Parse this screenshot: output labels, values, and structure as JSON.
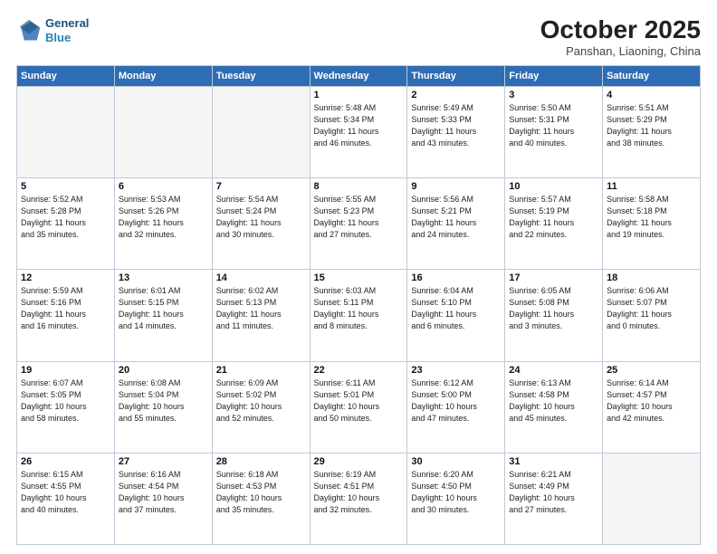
{
  "header": {
    "logo_line1": "General",
    "logo_line2": "Blue",
    "month": "October 2025",
    "location": "Panshan, Liaoning, China"
  },
  "weekdays": [
    "Sunday",
    "Monday",
    "Tuesday",
    "Wednesday",
    "Thursday",
    "Friday",
    "Saturday"
  ],
  "weeks": [
    [
      {
        "day": "",
        "info": ""
      },
      {
        "day": "",
        "info": ""
      },
      {
        "day": "",
        "info": ""
      },
      {
        "day": "1",
        "info": "Sunrise: 5:48 AM\nSunset: 5:34 PM\nDaylight: 11 hours\nand 46 minutes."
      },
      {
        "day": "2",
        "info": "Sunrise: 5:49 AM\nSunset: 5:33 PM\nDaylight: 11 hours\nand 43 minutes."
      },
      {
        "day": "3",
        "info": "Sunrise: 5:50 AM\nSunset: 5:31 PM\nDaylight: 11 hours\nand 40 minutes."
      },
      {
        "day": "4",
        "info": "Sunrise: 5:51 AM\nSunset: 5:29 PM\nDaylight: 11 hours\nand 38 minutes."
      }
    ],
    [
      {
        "day": "5",
        "info": "Sunrise: 5:52 AM\nSunset: 5:28 PM\nDaylight: 11 hours\nand 35 minutes."
      },
      {
        "day": "6",
        "info": "Sunrise: 5:53 AM\nSunset: 5:26 PM\nDaylight: 11 hours\nand 32 minutes."
      },
      {
        "day": "7",
        "info": "Sunrise: 5:54 AM\nSunset: 5:24 PM\nDaylight: 11 hours\nand 30 minutes."
      },
      {
        "day": "8",
        "info": "Sunrise: 5:55 AM\nSunset: 5:23 PM\nDaylight: 11 hours\nand 27 minutes."
      },
      {
        "day": "9",
        "info": "Sunrise: 5:56 AM\nSunset: 5:21 PM\nDaylight: 11 hours\nand 24 minutes."
      },
      {
        "day": "10",
        "info": "Sunrise: 5:57 AM\nSunset: 5:19 PM\nDaylight: 11 hours\nand 22 minutes."
      },
      {
        "day": "11",
        "info": "Sunrise: 5:58 AM\nSunset: 5:18 PM\nDaylight: 11 hours\nand 19 minutes."
      }
    ],
    [
      {
        "day": "12",
        "info": "Sunrise: 5:59 AM\nSunset: 5:16 PM\nDaylight: 11 hours\nand 16 minutes."
      },
      {
        "day": "13",
        "info": "Sunrise: 6:01 AM\nSunset: 5:15 PM\nDaylight: 11 hours\nand 14 minutes."
      },
      {
        "day": "14",
        "info": "Sunrise: 6:02 AM\nSunset: 5:13 PM\nDaylight: 11 hours\nand 11 minutes."
      },
      {
        "day": "15",
        "info": "Sunrise: 6:03 AM\nSunset: 5:11 PM\nDaylight: 11 hours\nand 8 minutes."
      },
      {
        "day": "16",
        "info": "Sunrise: 6:04 AM\nSunset: 5:10 PM\nDaylight: 11 hours\nand 6 minutes."
      },
      {
        "day": "17",
        "info": "Sunrise: 6:05 AM\nSunset: 5:08 PM\nDaylight: 11 hours\nand 3 minutes."
      },
      {
        "day": "18",
        "info": "Sunrise: 6:06 AM\nSunset: 5:07 PM\nDaylight: 11 hours\nand 0 minutes."
      }
    ],
    [
      {
        "day": "19",
        "info": "Sunrise: 6:07 AM\nSunset: 5:05 PM\nDaylight: 10 hours\nand 58 minutes."
      },
      {
        "day": "20",
        "info": "Sunrise: 6:08 AM\nSunset: 5:04 PM\nDaylight: 10 hours\nand 55 minutes."
      },
      {
        "day": "21",
        "info": "Sunrise: 6:09 AM\nSunset: 5:02 PM\nDaylight: 10 hours\nand 52 minutes."
      },
      {
        "day": "22",
        "info": "Sunrise: 6:11 AM\nSunset: 5:01 PM\nDaylight: 10 hours\nand 50 minutes."
      },
      {
        "day": "23",
        "info": "Sunrise: 6:12 AM\nSunset: 5:00 PM\nDaylight: 10 hours\nand 47 minutes."
      },
      {
        "day": "24",
        "info": "Sunrise: 6:13 AM\nSunset: 4:58 PM\nDaylight: 10 hours\nand 45 minutes."
      },
      {
        "day": "25",
        "info": "Sunrise: 6:14 AM\nSunset: 4:57 PM\nDaylight: 10 hours\nand 42 minutes."
      }
    ],
    [
      {
        "day": "26",
        "info": "Sunrise: 6:15 AM\nSunset: 4:55 PM\nDaylight: 10 hours\nand 40 minutes."
      },
      {
        "day": "27",
        "info": "Sunrise: 6:16 AM\nSunset: 4:54 PM\nDaylight: 10 hours\nand 37 minutes."
      },
      {
        "day": "28",
        "info": "Sunrise: 6:18 AM\nSunset: 4:53 PM\nDaylight: 10 hours\nand 35 minutes."
      },
      {
        "day": "29",
        "info": "Sunrise: 6:19 AM\nSunset: 4:51 PM\nDaylight: 10 hours\nand 32 minutes."
      },
      {
        "day": "30",
        "info": "Sunrise: 6:20 AM\nSunset: 4:50 PM\nDaylight: 10 hours\nand 30 minutes."
      },
      {
        "day": "31",
        "info": "Sunrise: 6:21 AM\nSunset: 4:49 PM\nDaylight: 10 hours\nand 27 minutes."
      },
      {
        "day": "",
        "info": ""
      }
    ]
  ]
}
